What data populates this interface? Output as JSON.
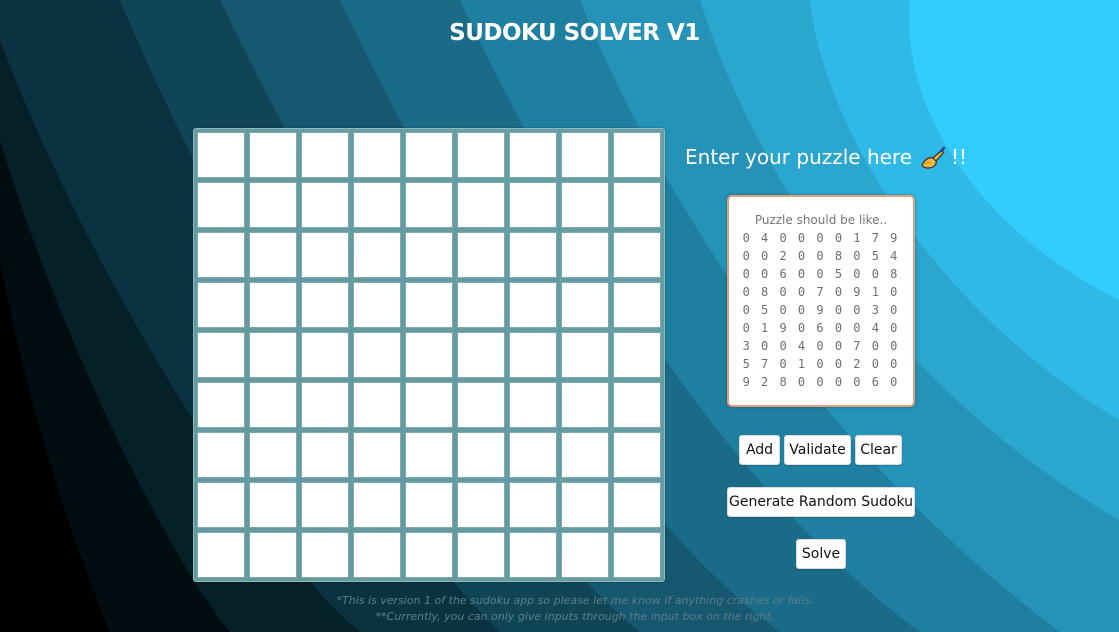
{
  "header": {
    "title": "SUDOKU SOLVER V1"
  },
  "board": {
    "rows": 9,
    "cols": 9,
    "cells": [
      [
        "",
        "",
        "",
        "",
        "",
        "",
        "",
        "",
        ""
      ],
      [
        "",
        "",
        "",
        "",
        "",
        "",
        "",
        "",
        ""
      ],
      [
        "",
        "",
        "",
        "",
        "",
        "",
        "",
        "",
        ""
      ],
      [
        "",
        "",
        "",
        "",
        "",
        "",
        "",
        "",
        ""
      ],
      [
        "",
        "",
        "",
        "",
        "",
        "",
        "",
        "",
        ""
      ],
      [
        "",
        "",
        "",
        "",
        "",
        "",
        "",
        "",
        ""
      ],
      [
        "",
        "",
        "",
        "",
        "",
        "",
        "",
        "",
        ""
      ],
      [
        "",
        "",
        "",
        "",
        "",
        "",
        "",
        "",
        ""
      ],
      [
        "",
        "",
        "",
        "",
        "",
        "",
        "",
        "",
        ""
      ]
    ]
  },
  "input_panel": {
    "prompt": "Enter your puzzle here",
    "prompt_icon": "writing-hand-icon",
    "prompt_suffix": "!!",
    "value": "",
    "placeholder_title": "Puzzle should be like..",
    "placeholder_rows": [
      "0 4 0 0 0 0 1 7 9",
      "0 0 2 0 0 8 0 5 4",
      "0 0 6 0 0 5 0 0 8",
      "0 8 0 0 7 0 9 1 0",
      "0 5 0 0 9 0 0 3 0",
      "0 1 9 0 6 0 0 4 0",
      "3 0 0 4 0 0 7 0 0",
      "5 7 0 1 0 0 2 0 0",
      "9 2 8 0 0 0 0 6 0"
    ]
  },
  "buttons": {
    "add": "Add",
    "validate": "Validate",
    "clear": "Clear",
    "generate": "Generate Random Sudoku",
    "solve": "Solve"
  },
  "footer": {
    "line1": "*This is version 1 of the sudoku app so please let me know if anything crashes or fails.",
    "line2": "**Currently, you can only give inputs through the input box on the right."
  },
  "colors": {
    "background_light": "#33ccff",
    "background_dark": "#000000",
    "board_frame": "#69a0a5",
    "puzzle_box_border": "#e2a07d"
  }
}
